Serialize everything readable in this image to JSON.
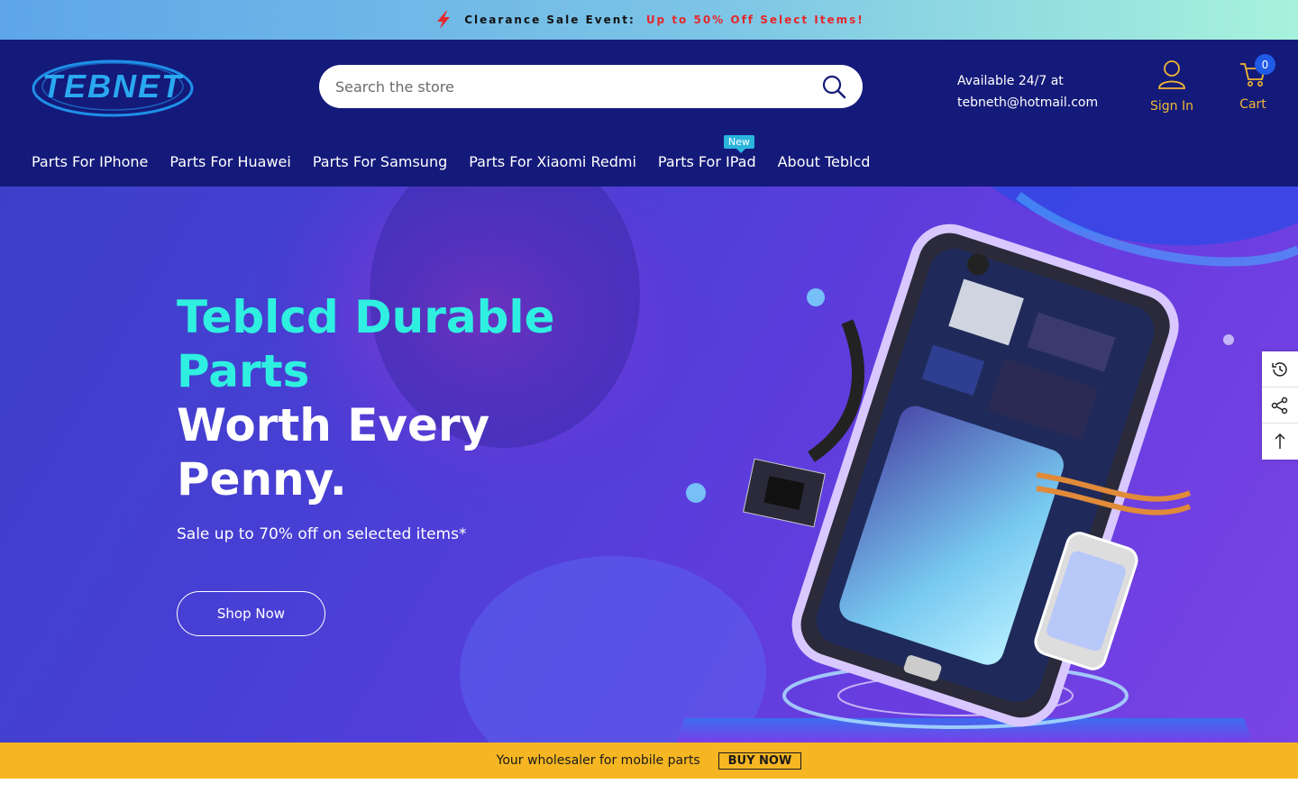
{
  "announcement": {
    "label": "Clearance Sale Event:",
    "highlight": "Up to 50% Off Select Items!",
    "icon": "bolt-icon",
    "highlight_color": "#e5272c"
  },
  "header": {
    "logo_text": "TEBNET",
    "search": {
      "placeholder": "Search the store"
    },
    "availability": {
      "line1": "Available 24/7 at",
      "line2": "tebneth@hotmail.com"
    },
    "account": {
      "label": "Sign In"
    },
    "cart": {
      "label": "Cart",
      "count": "0"
    },
    "background_color": "#141a7a",
    "accent_color": "#f1b733"
  },
  "nav": {
    "items": [
      {
        "label": "Parts For IPhone"
      },
      {
        "label": "Parts For Huawei"
      },
      {
        "label": "Parts For Samsung"
      },
      {
        "label": "Parts For Xiaomi Redmi"
      },
      {
        "label": "Parts For IPad",
        "tag": "New"
      },
      {
        "label": "About Teblcd"
      }
    ]
  },
  "hero": {
    "title_highlight": "Teblcd Durable Parts",
    "title_main": "Worth Every Penny.",
    "subtitle": "Sale up to 70% off on selected items*",
    "cta": "Shop Now",
    "highlight_color": "#2ff0e0"
  },
  "side_tools": [
    "history-icon",
    "share-icon",
    "arrow-up-icon"
  ],
  "promo_bar": {
    "text": "Your wholesaler for mobile parts",
    "button": "BUY NOW",
    "background_color": "#f6b623"
  }
}
